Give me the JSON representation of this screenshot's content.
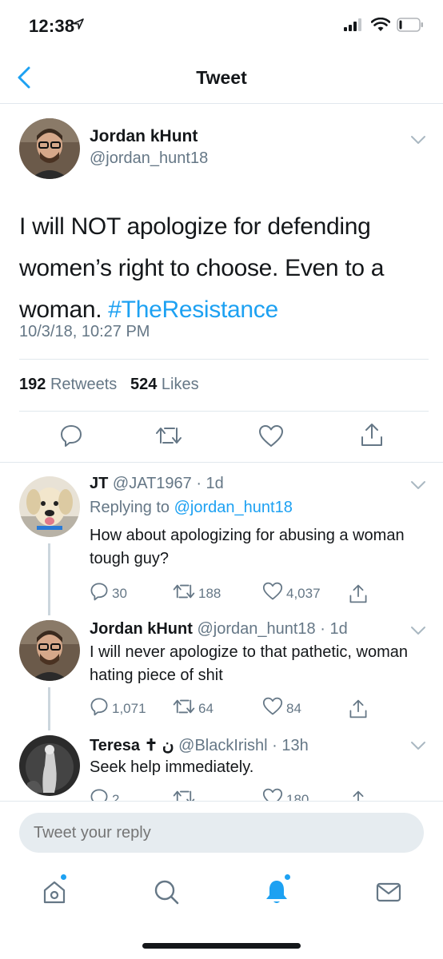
{
  "status_bar": {
    "time": "12:38"
  },
  "nav": {
    "title": "Tweet"
  },
  "main_tweet": {
    "name": "Jordan kHunt",
    "handle": "@jordan_hunt18",
    "text_plain": "I will NOT apologize for defending women’s right to choose. Even to a woman.",
    "hashtag": "#TheResistance",
    "date": "10/3/18, 10:27 PM",
    "retweet_count": "192",
    "retweet_label": "Retweets",
    "like_count": "524",
    "like_label": "Likes"
  },
  "replies": [
    {
      "name": "JT",
      "handle": "@JAT1967",
      "time": "· 1d",
      "replying_prefix": "Replying to",
      "replying_to": "@jordan_hunt18",
      "text": "How about apologizing for abusing a woman tough guy?",
      "replies": "30",
      "retweets": "188",
      "likes": "4,037"
    },
    {
      "name": "Jordan kHunt",
      "handle": "@jordan_hunt18",
      "time": "· 1d",
      "text": "I will never apologize to that pathetic, woman hating piece of shit",
      "replies": "1,071",
      "retweets": "64",
      "likes": "84"
    },
    {
      "name": "Teresa ✝ ن",
      "handle": "@BlackIrishl",
      "time": "· 13h",
      "text": "Seek help immediately.",
      "replies": "2",
      "retweets": "",
      "likes": "180"
    }
  ],
  "reply_bar": {
    "placeholder": "Tweet your reply"
  },
  "colors": {
    "accent": "#1da1f2",
    "secondary_text": "#657786",
    "divider": "#e1e8ed"
  },
  "icons": [
    "back-chevron-icon",
    "reply-icon",
    "retweet-icon",
    "like-icon",
    "share-icon",
    "home-icon",
    "search-icon",
    "notifications-icon",
    "messages-icon"
  ]
}
